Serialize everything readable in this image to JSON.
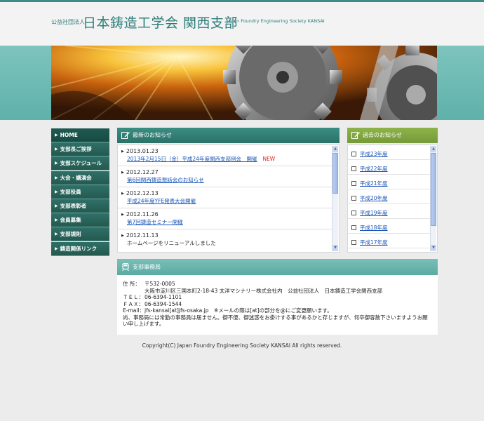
{
  "header": {
    "org_type": "公益社団法人",
    "title": "日本鋳造工学会 関西支部",
    "english_name": "Japan Foundry Engineering Society KANSAI"
  },
  "nav": {
    "items": [
      {
        "label": "HOME"
      },
      {
        "label": "支部長ご挨拶"
      },
      {
        "label": "支部スケジュール"
      },
      {
        "label": "大会・講演会"
      },
      {
        "label": "支部役員"
      },
      {
        "label": "支部表彰者"
      },
      {
        "label": "会員募集"
      },
      {
        "label": "支部規則"
      },
      {
        "label": "鋳造関係リンク"
      }
    ]
  },
  "news": {
    "title": "最新のお知らせ",
    "new_badge": "NEW",
    "items": [
      {
        "date": "2013.01.23",
        "text": "2013年2月15日（金）平成24年度関西支部例会　開催"
      },
      {
        "date": "2012.12.27",
        "text": "第6回関西鋳造懇話会のお知らせ"
      },
      {
        "date": "2012.12.13",
        "text": "平成24年度YFE発表大会開催"
      },
      {
        "date": "2012.11.26",
        "text": "第7回鋳造セミナー開催"
      },
      {
        "date": "2012.11.13",
        "text": "ホームページをリニューアルしました"
      }
    ]
  },
  "past": {
    "title": "過去のお知らせ",
    "items": [
      {
        "label": "平成23年度"
      },
      {
        "label": "平成22年度"
      },
      {
        "label": "平成21年度"
      },
      {
        "label": "平成20年度"
      },
      {
        "label": "平成19年度"
      },
      {
        "label": "平成18年度"
      },
      {
        "label": "平成17年度"
      }
    ]
  },
  "office": {
    "title": "支部事務局",
    "address_label": "住 所：",
    "postal": "〒532-0005",
    "address": "大阪市淀川区三国本町2-18-43 太洋マシナリー株式会社内　公益社団法人　日本鋳造工学会関西支部",
    "tel_label": "ＴＥＬ：",
    "tel": "06-6394-1101",
    "fax_label": "ＦＡＸ：",
    "fax": "06-6394-1544",
    "email_label": "E-mail：",
    "email": "jfs-kansai[at]jfs-osaka.jp　※メールの際は[at]の部分を@にご変更願います。",
    "note": "尚、事務局には常勤の事務員は居ません。御不便、御迷惑をお掛けする事があるかと存じますが、何卒御容赦下さいますようお願い申し上げます。"
  },
  "footer": {
    "copyright": "Copyright(C) Japan Foundry Engineering Society KANSAI All rights reserved."
  },
  "colors": {
    "accent": "#2a7d79",
    "nav": "#24594f",
    "past_header": "#8fb34a",
    "new_badge": "#e0201a"
  }
}
